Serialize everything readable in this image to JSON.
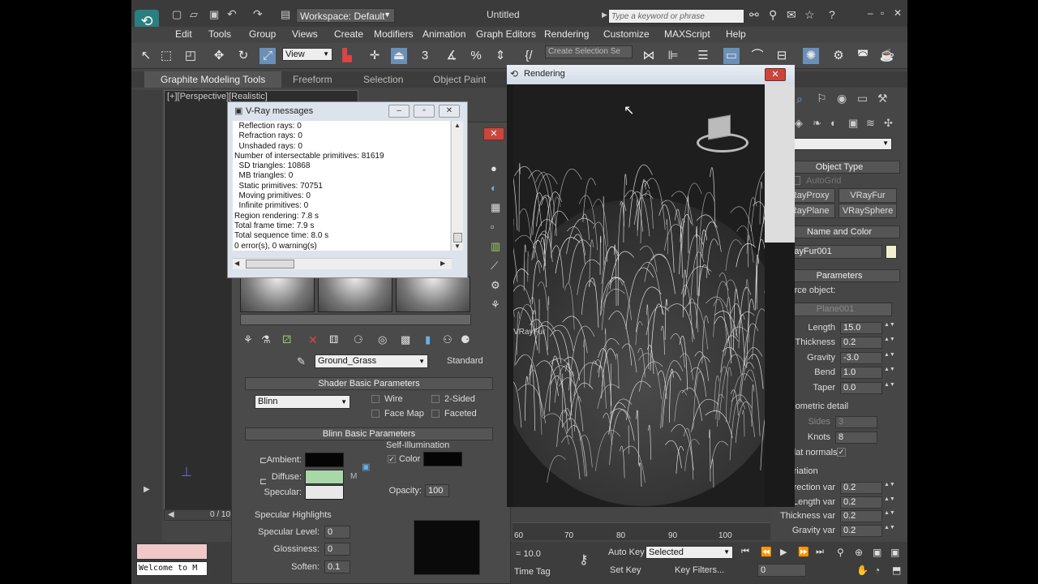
{
  "app": {
    "workspace": "Workspace: Default",
    "title": "Untitled",
    "search_placeholder": "Type a keyword or phrase"
  },
  "menu": [
    "Edit",
    "Tools",
    "Group",
    "Views",
    "Create",
    "Modifiers",
    "Animation",
    "Graph Editors",
    "Rendering",
    "Customize",
    "MAXScript",
    "Help"
  ],
  "toolbar": {
    "ref_coord": "View",
    "selection_set_placeholder": "Create Selection Se"
  },
  "ribbon_tabs": [
    "Graphite Modeling Tools",
    "Freeform",
    "Selection",
    "Object Paint"
  ],
  "viewport": {
    "label": "[+][Perspective][Realistic]",
    "frame_counter": "0 / 10"
  },
  "vray_messages": {
    "title": "V-Ray messages",
    "lines": [
      "  Reflection rays: 0",
      "  Refraction rays: 0",
      "  Unshaded rays: 0",
      "Number of intersectable primitives: 81619",
      "  SD triangles: 10868",
      "  MB triangles: 0",
      "  Static primitives: 70751",
      "  Moving primitives: 0",
      "  Infinite primitives: 0",
      "Region rendering: 7.8 s",
      "Total frame time: 7.9 s",
      "Total sequence time: 8.0 s",
      "0 error(s), 0 warning(s)",
      "================================"
    ]
  },
  "rendering_window": {
    "title": "Rendering",
    "object_label": "VRayFur"
  },
  "material_editor": {
    "material_name": "Ground_Grass",
    "material_type": "Standard",
    "shader_rollout": "Shader Basic Parameters",
    "shader": "Blinn",
    "wire": "Wire",
    "two_sided": "2-Sided",
    "face_map": "Face Map",
    "faceted": "Faceted",
    "blinn_rollout": "Blinn Basic Parameters",
    "self_illumination": "Self-Illumination",
    "ambient": "Ambient:",
    "diffuse": "Diffuse:",
    "specular": "Specular:",
    "color_label": "Color",
    "opacity_label": "Opacity:",
    "opacity": "100",
    "map_letter": "M",
    "specular_highlights": "Specular Highlights",
    "specular_level_label": "Specular Level:",
    "specular_level": "0",
    "glossiness_label": "Glossiness:",
    "glossiness": "0",
    "soften_label": "Soften:",
    "soften": "0.1",
    "diffuse_color": "#a8d8a8",
    "specular_color": "#e8e8e8"
  },
  "command_panel": {
    "object_type": "Object Type",
    "autogrid": "AutoGrid",
    "buttons": [
      "VRayProxy",
      "VRayFur",
      "VRayPlane",
      "VRaySphere"
    ],
    "name_and_color": "Name and Color",
    "object_name": "VRayFur001",
    "parameters": "Parameters",
    "source_object_label": "Source object:",
    "source_object": "Plane001",
    "params": [
      {
        "label": "Length",
        "value": "15.0"
      },
      {
        "label": "Thickness",
        "value": "0.2"
      },
      {
        "label": "Gravity",
        "value": "-3.0"
      },
      {
        "label": "Bend",
        "value": "1.0"
      },
      {
        "label": "Taper",
        "value": "0.0"
      }
    ],
    "geometric_detail": "Geometric detail",
    "sides_label": "Sides",
    "sides": "3",
    "knots_label": "Knots",
    "knots": "8",
    "flat_normals": "Flat normals",
    "variation": "Variation",
    "variations": [
      {
        "label": "Direction var",
        "value": "0.2"
      },
      {
        "label": "Length var",
        "value": "0.2"
      },
      {
        "label": "Thickness var",
        "value": "0.2"
      },
      {
        "label": "Gravity var",
        "value": "0.2"
      }
    ]
  },
  "timeline": {
    "ticks": [
      "60",
      "70",
      "80",
      "90",
      "100"
    ],
    "grid_value": "= 10.0",
    "auto_key": "Auto Key",
    "key_mode": "Selected",
    "set_key": "Set Key",
    "key_filters": "Key Filters...",
    "time_tag": "Time Tag",
    "frame": "0",
    "welcome": "Welcome to M"
  }
}
